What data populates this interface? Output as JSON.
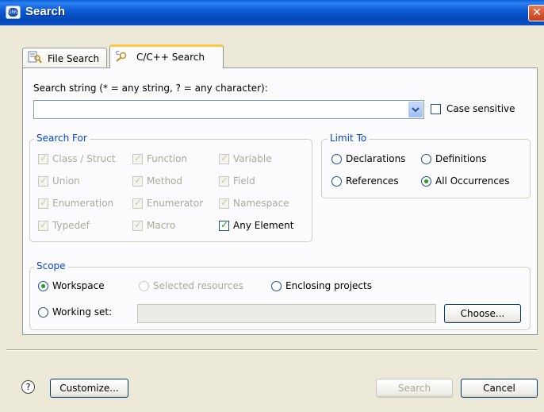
{
  "window": {
    "title": "Search",
    "close_glyph": "✕"
  },
  "tabs": [
    {
      "label": "File Search",
      "icon": "file-search-icon"
    },
    {
      "label": "C/C++ Search",
      "icon": "cpp-search-icon",
      "selected": true
    }
  ],
  "search_string": {
    "label": "Search string (* = any string, ? = any character):",
    "value": "",
    "case_sensitive_label": "Case sensitive",
    "case_sensitive": false
  },
  "search_for": {
    "title": "Search For",
    "items": [
      {
        "label": "Class / Struct",
        "checked": true,
        "enabled": false
      },
      {
        "label": "Function",
        "checked": true,
        "enabled": false
      },
      {
        "label": "Variable",
        "checked": true,
        "enabled": false
      },
      {
        "label": "Union",
        "checked": true,
        "enabled": false
      },
      {
        "label": "Method",
        "checked": true,
        "enabled": false
      },
      {
        "label": "Field",
        "checked": true,
        "enabled": false
      },
      {
        "label": "Enumeration",
        "checked": true,
        "enabled": false
      },
      {
        "label": "Enumerator",
        "checked": true,
        "enabled": false
      },
      {
        "label": "Namespace",
        "checked": true,
        "enabled": false
      },
      {
        "label": "Typedef",
        "checked": true,
        "enabled": false
      },
      {
        "label": "Macro",
        "checked": true,
        "enabled": false
      },
      {
        "label": "Any Element",
        "checked": true,
        "enabled": true
      }
    ]
  },
  "limit_to": {
    "title": "Limit To",
    "options": [
      {
        "label": "Declarations",
        "selected": false
      },
      {
        "label": "Definitions",
        "selected": false
      },
      {
        "label": "References",
        "selected": false
      },
      {
        "label": "All Occurrences",
        "selected": true
      }
    ]
  },
  "scope": {
    "title": "Scope",
    "options": [
      {
        "label": "Workspace",
        "selected": true,
        "enabled": true
      },
      {
        "label": "Selected resources",
        "selected": false,
        "enabled": false
      },
      {
        "label": "Enclosing projects",
        "selected": false,
        "enabled": true
      },
      {
        "label": "Working set:",
        "selected": false,
        "enabled": true
      }
    ],
    "working_set_value": "",
    "choose_label": "Choose..."
  },
  "footer": {
    "help_glyph": "?",
    "customize_label": "Customize...",
    "search_label": "Search",
    "cancel_label": "Cancel"
  },
  "colors": {
    "titlebar": "#0a58d0",
    "group_title": "#0046d5",
    "check": "#21a121",
    "tab_highlight": "#ffc83c"
  }
}
